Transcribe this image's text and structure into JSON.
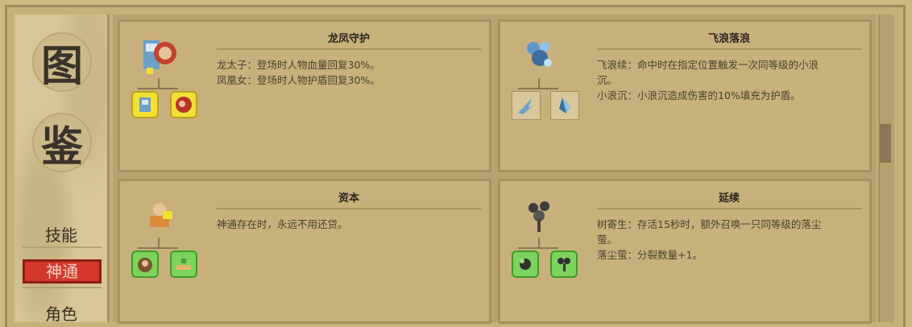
{
  "sidebar": {
    "seal_top": "图",
    "seal_bottom": "鉴",
    "items": [
      {
        "label": "技能"
      },
      {
        "label": "神通"
      },
      {
        "label": "角色"
      }
    ],
    "active_index": 1
  },
  "cards": [
    {
      "title": "龙凤守护",
      "lines": [
        "龙太子：登场时人物血量回复30%。",
        "凤凰女：登场时人物护盾回复30%。"
      ],
      "main_icon": "dragon-phoenix-icon",
      "sub_icons": [
        "dragon-prince-icon",
        "phoenix-girl-icon"
      ],
      "sub_style": "yellow"
    },
    {
      "title": "飞浪落浪",
      "lines": [
        "飞浪续：命中时在指定位置触发一次同等级的小浪",
        "沉。",
        "小浪沉：小浪沉造成伤害的10%填充为护盾。"
      ],
      "main_icon": "wave-burst-icon",
      "sub_icons": [
        "wave-slash-icon",
        "water-drop-icon"
      ],
      "sub_style": "plain"
    },
    {
      "title": "资本",
      "lines": [
        "神通存在时，永远不用还贷。"
      ],
      "main_icon": "capital-icon",
      "sub_icons": [
        "money-bag-icon",
        "worm-icon"
      ],
      "sub_style": "green"
    },
    {
      "title": "延续",
      "lines": [
        "树寄生：存活15秒时，额外召唤一只同等级的落尘",
        "萤。",
        "落尘萤：分裂数量+1。"
      ],
      "main_icon": "tree-parasite-icon",
      "sub_icons": [
        "firefly-icon",
        "sprout-icon"
      ],
      "sub_style": "green"
    }
  ],
  "colors": {
    "active_tab": "#d5392d",
    "panel_bg": "#c8b07c",
    "text": "#4a4034"
  }
}
